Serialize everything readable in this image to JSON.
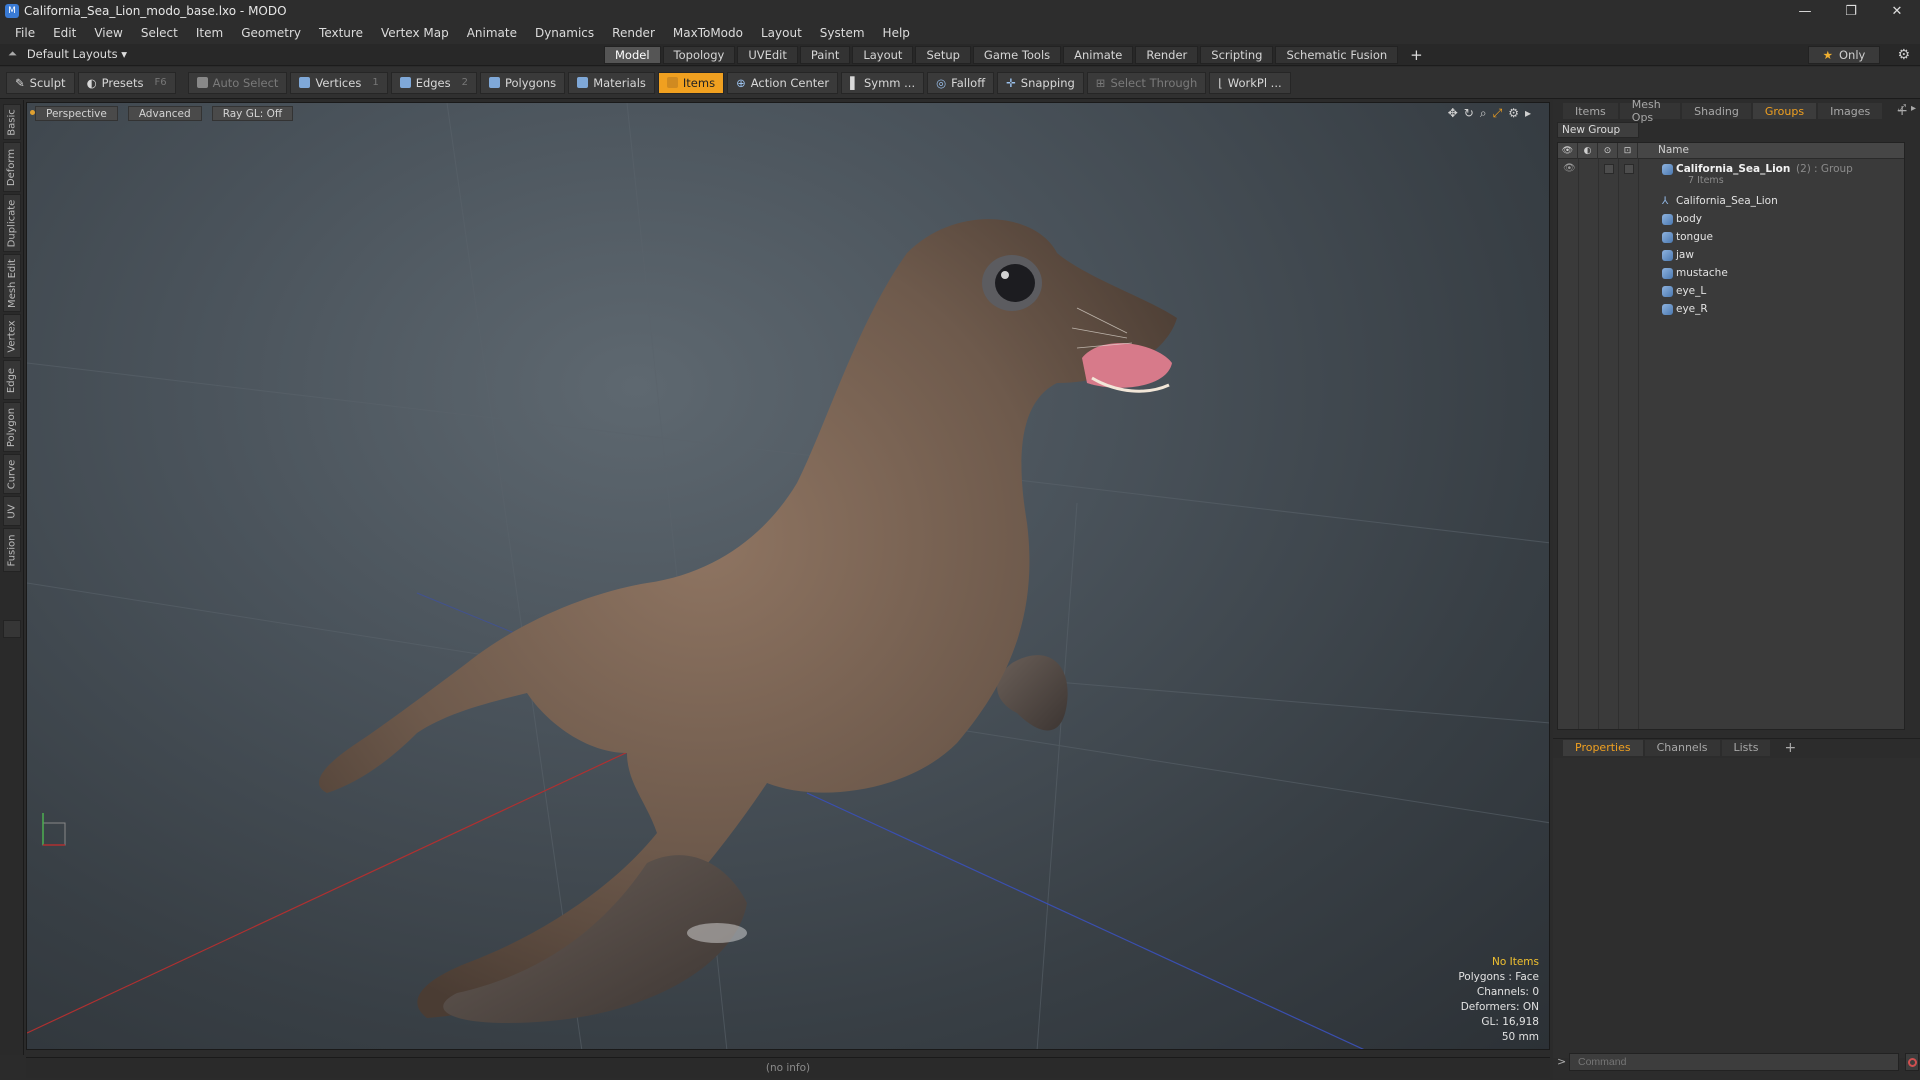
{
  "window": {
    "title": "California_Sea_Lion_modo_base.lxo - MODO",
    "controls": [
      "—",
      "❐",
      "✕"
    ]
  },
  "menu": [
    "File",
    "Edit",
    "View",
    "Select",
    "Item",
    "Geometry",
    "Texture",
    "Vertex Map",
    "Animate",
    "Dynamics",
    "Render",
    "MaxToModo",
    "Layout",
    "System",
    "Help"
  ],
  "layout_bar": {
    "layout_name": "Default Layouts ▾",
    "tabs": [
      "Model",
      "Topology",
      "UVEdit",
      "Paint",
      "Layout",
      "Setup",
      "Game Tools",
      "Animate",
      "Render",
      "Scripting",
      "Schematic Fusion"
    ],
    "active_tab": "Model",
    "plus": "+",
    "only_label": "Only"
  },
  "toolbar": {
    "sculpt": "Sculpt",
    "presets": "Presets",
    "presets_key": "F6",
    "auto_select": "Auto Select",
    "vertices": "Vertices",
    "vertices_key": "1",
    "edges": "Edges",
    "edges_key": "2",
    "polygons": "Polygons",
    "materials": "Materials",
    "items": "Items",
    "action_center": "Action Center",
    "symm": "Symm ...",
    "falloff": "Falloff",
    "snapping": "Snapping",
    "select_through": "Select Through",
    "workplane": "WorkPl ..."
  },
  "left_tabs": [
    "Basic",
    "Deform",
    "Duplicate",
    "Mesh Edit",
    "Vertex",
    "Edge",
    "Polygon",
    "Curve",
    "UV",
    "Fusion"
  ],
  "viewport": {
    "view": "Perspective",
    "shading": "Advanced",
    "raygl": "Ray GL: Off",
    "info": {
      "selection": "No Items",
      "polygons": "Polygons : Face",
      "channels": "Channels: 0",
      "deformers": "Deformers: ON",
      "gl": "GL: 16,918",
      "lens": "50 mm"
    }
  },
  "status": "(no info)",
  "right_panel": {
    "tabs": [
      "Items",
      "Mesh Ops",
      "Shading",
      "Groups",
      "Images"
    ],
    "active_tab": "Groups",
    "new_group": "New Group",
    "column_name": "Name",
    "group": {
      "name": "California_Sea_Lion",
      "count": "(2)",
      "type": ": Group",
      "items_label": "7 Items"
    },
    "children": [
      "California_Sea_Lion",
      "body",
      "tongue",
      "jaw",
      "mustache",
      "eye_L",
      "eye_R"
    ],
    "props_tabs": [
      "Properties",
      "Channels",
      "Lists"
    ],
    "props_active": "Properties",
    "command_placeholder": "Command",
    "command_prefix": ">"
  },
  "colors": {
    "accent": "#f0a020",
    "panel": "#2c2c2c",
    "x_axis": "#b03030",
    "z_axis": "#3a4fb0"
  }
}
